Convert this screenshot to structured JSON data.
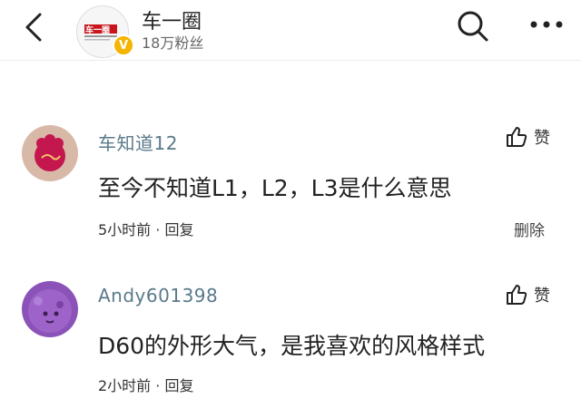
{
  "header": {
    "account_name": "车一圈",
    "fans": "18万粉丝",
    "logo_text": "车一圈",
    "badge": "V"
  },
  "comments": [
    {
      "username": "车知道12",
      "text": "至今不知道L1，L2，L3是什么意思",
      "time": "5小时前",
      "separator": "·",
      "reply_label": "回复",
      "like_label": "赞",
      "delete_label": "删除"
    },
    {
      "username": "Andy601398",
      "text": "D60的外形大气，是我喜欢的风格样式",
      "time": "2小时前",
      "separator": "·",
      "reply_label": "回复",
      "like_label": "赞"
    }
  ]
}
